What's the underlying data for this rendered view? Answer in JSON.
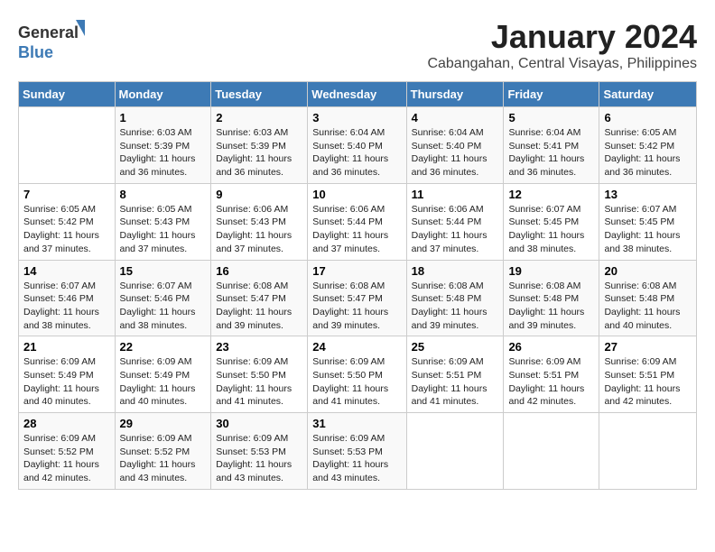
{
  "logo": {
    "general": "General",
    "blue": "Blue"
  },
  "title": {
    "month_year": "January 2024",
    "location": "Cabangahan, Central Visayas, Philippines"
  },
  "headers": [
    "Sunday",
    "Monday",
    "Tuesday",
    "Wednesday",
    "Thursday",
    "Friday",
    "Saturday"
  ],
  "weeks": [
    [
      {
        "day": "",
        "sunrise": "",
        "sunset": "",
        "daylight": ""
      },
      {
        "day": "1",
        "sunrise": "Sunrise: 6:03 AM",
        "sunset": "Sunset: 5:39 PM",
        "daylight": "Daylight: 11 hours and 36 minutes."
      },
      {
        "day": "2",
        "sunrise": "Sunrise: 6:03 AM",
        "sunset": "Sunset: 5:39 PM",
        "daylight": "Daylight: 11 hours and 36 minutes."
      },
      {
        "day": "3",
        "sunrise": "Sunrise: 6:04 AM",
        "sunset": "Sunset: 5:40 PM",
        "daylight": "Daylight: 11 hours and 36 minutes."
      },
      {
        "day": "4",
        "sunrise": "Sunrise: 6:04 AM",
        "sunset": "Sunset: 5:40 PM",
        "daylight": "Daylight: 11 hours and 36 minutes."
      },
      {
        "day": "5",
        "sunrise": "Sunrise: 6:04 AM",
        "sunset": "Sunset: 5:41 PM",
        "daylight": "Daylight: 11 hours and 36 minutes."
      },
      {
        "day": "6",
        "sunrise": "Sunrise: 6:05 AM",
        "sunset": "Sunset: 5:42 PM",
        "daylight": "Daylight: 11 hours and 36 minutes."
      }
    ],
    [
      {
        "day": "7",
        "sunrise": "Sunrise: 6:05 AM",
        "sunset": "Sunset: 5:42 PM",
        "daylight": "Daylight: 11 hours and 37 minutes."
      },
      {
        "day": "8",
        "sunrise": "Sunrise: 6:05 AM",
        "sunset": "Sunset: 5:43 PM",
        "daylight": "Daylight: 11 hours and 37 minutes."
      },
      {
        "day": "9",
        "sunrise": "Sunrise: 6:06 AM",
        "sunset": "Sunset: 5:43 PM",
        "daylight": "Daylight: 11 hours and 37 minutes."
      },
      {
        "day": "10",
        "sunrise": "Sunrise: 6:06 AM",
        "sunset": "Sunset: 5:44 PM",
        "daylight": "Daylight: 11 hours and 37 minutes."
      },
      {
        "day": "11",
        "sunrise": "Sunrise: 6:06 AM",
        "sunset": "Sunset: 5:44 PM",
        "daylight": "Daylight: 11 hours and 37 minutes."
      },
      {
        "day": "12",
        "sunrise": "Sunrise: 6:07 AM",
        "sunset": "Sunset: 5:45 PM",
        "daylight": "Daylight: 11 hours and 38 minutes."
      },
      {
        "day": "13",
        "sunrise": "Sunrise: 6:07 AM",
        "sunset": "Sunset: 5:45 PM",
        "daylight": "Daylight: 11 hours and 38 minutes."
      }
    ],
    [
      {
        "day": "14",
        "sunrise": "Sunrise: 6:07 AM",
        "sunset": "Sunset: 5:46 PM",
        "daylight": "Daylight: 11 hours and 38 minutes."
      },
      {
        "day": "15",
        "sunrise": "Sunrise: 6:07 AM",
        "sunset": "Sunset: 5:46 PM",
        "daylight": "Daylight: 11 hours and 38 minutes."
      },
      {
        "day": "16",
        "sunrise": "Sunrise: 6:08 AM",
        "sunset": "Sunset: 5:47 PM",
        "daylight": "Daylight: 11 hours and 39 minutes."
      },
      {
        "day": "17",
        "sunrise": "Sunrise: 6:08 AM",
        "sunset": "Sunset: 5:47 PM",
        "daylight": "Daylight: 11 hours and 39 minutes."
      },
      {
        "day": "18",
        "sunrise": "Sunrise: 6:08 AM",
        "sunset": "Sunset: 5:48 PM",
        "daylight": "Daylight: 11 hours and 39 minutes."
      },
      {
        "day": "19",
        "sunrise": "Sunrise: 6:08 AM",
        "sunset": "Sunset: 5:48 PM",
        "daylight": "Daylight: 11 hours and 39 minutes."
      },
      {
        "day": "20",
        "sunrise": "Sunrise: 6:08 AM",
        "sunset": "Sunset: 5:48 PM",
        "daylight": "Daylight: 11 hours and 40 minutes."
      }
    ],
    [
      {
        "day": "21",
        "sunrise": "Sunrise: 6:09 AM",
        "sunset": "Sunset: 5:49 PM",
        "daylight": "Daylight: 11 hours and 40 minutes."
      },
      {
        "day": "22",
        "sunrise": "Sunrise: 6:09 AM",
        "sunset": "Sunset: 5:49 PM",
        "daylight": "Daylight: 11 hours and 40 minutes."
      },
      {
        "day": "23",
        "sunrise": "Sunrise: 6:09 AM",
        "sunset": "Sunset: 5:50 PM",
        "daylight": "Daylight: 11 hours and 41 minutes."
      },
      {
        "day": "24",
        "sunrise": "Sunrise: 6:09 AM",
        "sunset": "Sunset: 5:50 PM",
        "daylight": "Daylight: 11 hours and 41 minutes."
      },
      {
        "day": "25",
        "sunrise": "Sunrise: 6:09 AM",
        "sunset": "Sunset: 5:51 PM",
        "daylight": "Daylight: 11 hours and 41 minutes."
      },
      {
        "day": "26",
        "sunrise": "Sunrise: 6:09 AM",
        "sunset": "Sunset: 5:51 PM",
        "daylight": "Daylight: 11 hours and 42 minutes."
      },
      {
        "day": "27",
        "sunrise": "Sunrise: 6:09 AM",
        "sunset": "Sunset: 5:51 PM",
        "daylight": "Daylight: 11 hours and 42 minutes."
      }
    ],
    [
      {
        "day": "28",
        "sunrise": "Sunrise: 6:09 AM",
        "sunset": "Sunset: 5:52 PM",
        "daylight": "Daylight: 11 hours and 42 minutes."
      },
      {
        "day": "29",
        "sunrise": "Sunrise: 6:09 AM",
        "sunset": "Sunset: 5:52 PM",
        "daylight": "Daylight: 11 hours and 43 minutes."
      },
      {
        "day": "30",
        "sunrise": "Sunrise: 6:09 AM",
        "sunset": "Sunset: 5:53 PM",
        "daylight": "Daylight: 11 hours and 43 minutes."
      },
      {
        "day": "31",
        "sunrise": "Sunrise: 6:09 AM",
        "sunset": "Sunset: 5:53 PM",
        "daylight": "Daylight: 11 hours and 43 minutes."
      },
      {
        "day": "",
        "sunrise": "",
        "sunset": "",
        "daylight": ""
      },
      {
        "day": "",
        "sunrise": "",
        "sunset": "",
        "daylight": ""
      },
      {
        "day": "",
        "sunrise": "",
        "sunset": "",
        "daylight": ""
      }
    ]
  ]
}
